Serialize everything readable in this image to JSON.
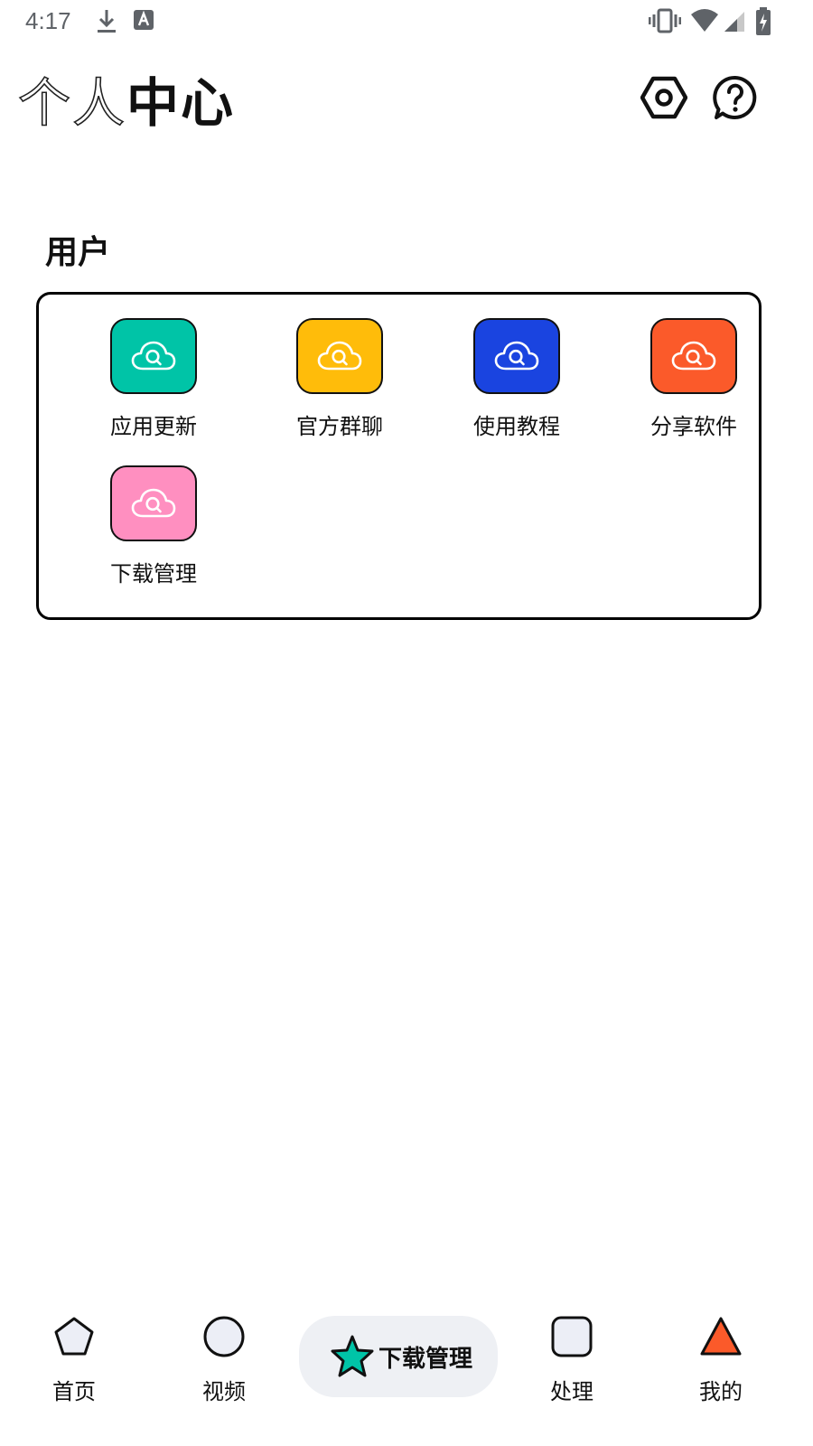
{
  "status_bar": {
    "time": "4:17",
    "left_icons": [
      "download-icon",
      "text-a-icon"
    ],
    "right_icons": [
      "vibrate-icon",
      "wifi-icon",
      "signal-icon",
      "battery-charging-icon"
    ]
  },
  "header": {
    "title_outline": "个人",
    "title_solid": "中心",
    "actions": [
      {
        "icon": "settings-hex-icon"
      },
      {
        "icon": "help-bubble-icon"
      }
    ]
  },
  "section": {
    "title": "用户",
    "items": [
      {
        "label": "应用更新",
        "icon": "cloud-search-icon",
        "color": "#00c4a7"
      },
      {
        "label": "官方群聊",
        "icon": "cloud-search-icon",
        "color": "#ffbc0a"
      },
      {
        "label": "使用教程",
        "icon": "cloud-search-icon",
        "color": "#1a44e0"
      },
      {
        "label": "分享软件",
        "icon": "cloud-search-icon",
        "color": "#fb5a2a"
      },
      {
        "label": "下载管理",
        "icon": "cloud-search-icon",
        "color": "#ff8fc0"
      }
    ]
  },
  "bottom_nav": {
    "items": [
      {
        "label": "首页",
        "icon": "pentagon-icon"
      },
      {
        "label": "视频",
        "icon": "circle-icon"
      },
      {
        "label": "处理",
        "icon": "rounded-square-icon"
      },
      {
        "label": "我的",
        "icon": "triangle-icon",
        "color": "#fb5a2a"
      }
    ],
    "active": {
      "label": "下载管理",
      "icon": "star-icon",
      "color": "#00c4a7"
    }
  },
  "colors": {
    "icon_fill_neutral": "#eceef6",
    "active_pill_bg": "#eef0f4"
  }
}
